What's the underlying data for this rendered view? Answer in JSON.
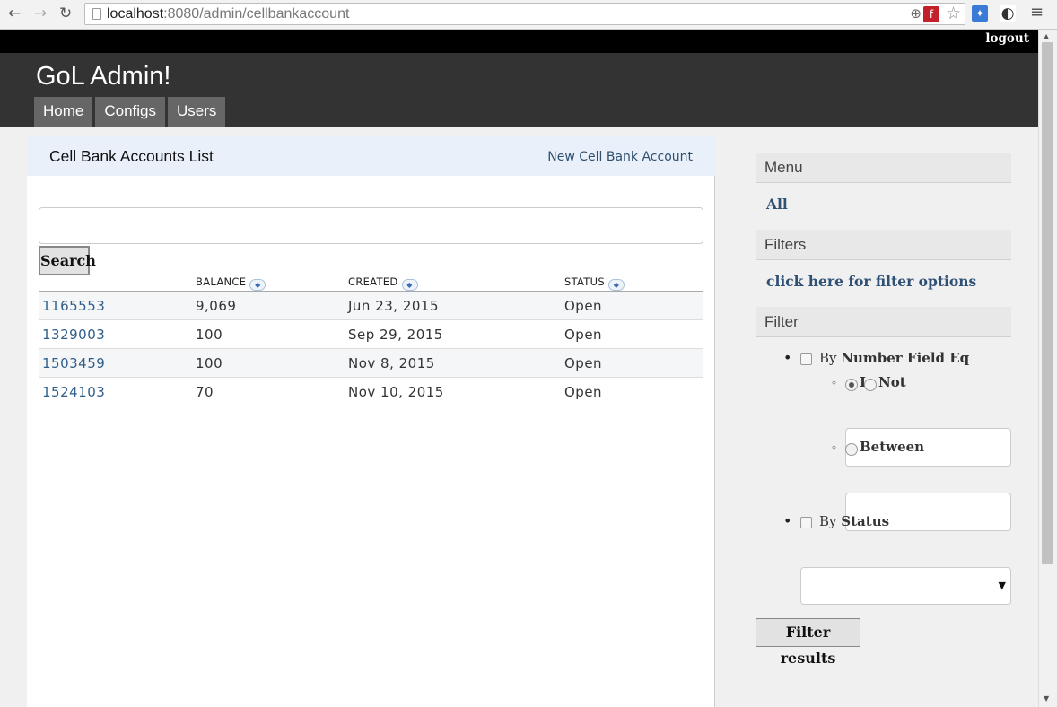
{
  "browser": {
    "url_host": "localhost",
    "url_rest": ":8080/admin/cellbankaccount"
  },
  "topbar": {
    "logout_label": "logout"
  },
  "header": {
    "title": "GoL Admin!",
    "nav": [
      {
        "label": "Home"
      },
      {
        "label": "Configs"
      },
      {
        "label": "Users"
      }
    ]
  },
  "main": {
    "title": "Cell Bank Accounts List",
    "new_link": "New Cell Bank Account",
    "search": {
      "value": "",
      "button_label": "Search"
    },
    "table": {
      "columns": [
        "",
        "BALANCE",
        "CREATED",
        "STATUS"
      ],
      "rows": [
        {
          "id": "1165553",
          "balance": "9,069",
          "created": "Jun 23, 2015",
          "status": "Open"
        },
        {
          "id": "1329003",
          "balance": "100",
          "created": "Sep 29, 2015",
          "status": "Open"
        },
        {
          "id": "1503459",
          "balance": "100",
          "created": "Nov 8, 2015",
          "status": "Open"
        },
        {
          "id": "1524103",
          "balance": "70",
          "created": "Nov 10, 2015",
          "status": "Open"
        }
      ]
    }
  },
  "sidebar": {
    "menu_heading": "Menu",
    "menu_all": "All",
    "filters_heading": "Filters",
    "filter_options_link": "click here for filter options",
    "filter_heading": "Filter",
    "number_filter": {
      "by": "By",
      "field": "Number Field Eq",
      "opt_i": "I",
      "opt_not": "Not",
      "opt_between": "Between"
    },
    "status_filter": {
      "by": "By",
      "field": "Status",
      "selected": ""
    },
    "filter_button": "Filter results"
  }
}
